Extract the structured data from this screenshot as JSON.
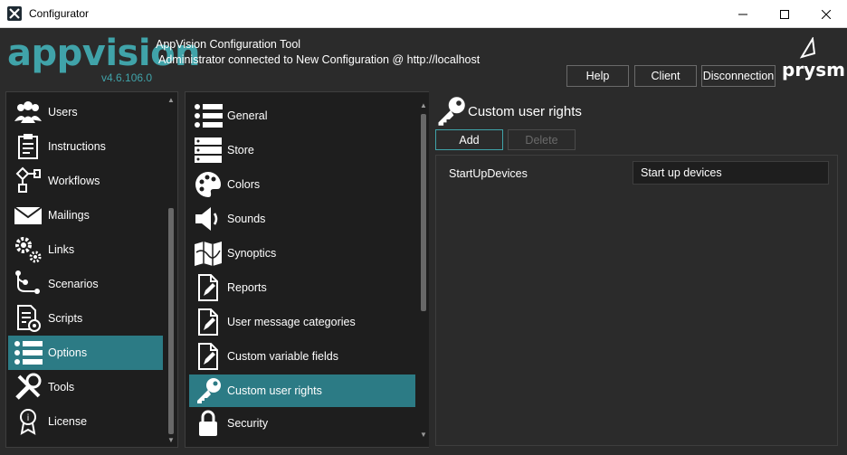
{
  "window": {
    "title": "Configurator",
    "minimize_glyph": "─",
    "maximize_glyph": "☐",
    "close_glyph": "✕"
  },
  "header": {
    "logo": "appvision",
    "version": "v4.6.106.0",
    "title": "AppVision Configuration Tool",
    "subtitle": "Administrator connected to New Configuration @ http://localhost",
    "buttons": {
      "help": "Help",
      "client": "Client",
      "disconnection": "Disconnection"
    },
    "brand": "prysm",
    "colors": {
      "accent": "#40a3a9",
      "selection": "#2c7b85"
    }
  },
  "nav": {
    "items": [
      {
        "label": "Users",
        "icon": "users-icon"
      },
      {
        "label": "Instructions",
        "icon": "clipboard-icon"
      },
      {
        "label": "Workflows",
        "icon": "workflow-icon"
      },
      {
        "label": "Mailings",
        "icon": "envelope-icon"
      },
      {
        "label": "Links",
        "icon": "gears-icon"
      },
      {
        "label": "Scenarios",
        "icon": "scenario-icon"
      },
      {
        "label": "Scripts",
        "icon": "script-icon"
      },
      {
        "label": "Options",
        "icon": "list-icon",
        "selected": true
      },
      {
        "label": "Tools",
        "icon": "tools-icon"
      },
      {
        "label": "License",
        "icon": "certificate-icon"
      }
    ]
  },
  "options": {
    "items": [
      {
        "label": "General",
        "icon": "list-icon"
      },
      {
        "label": "Store",
        "icon": "server-icon"
      },
      {
        "label": "Colors",
        "icon": "palette-icon"
      },
      {
        "label": "Sounds",
        "icon": "speaker-icon"
      },
      {
        "label": "Synoptics",
        "icon": "map-icon"
      },
      {
        "label": "Reports",
        "icon": "document-edit-icon"
      },
      {
        "label": "User message categories",
        "icon": "document-edit-icon"
      },
      {
        "label": "Custom variable fields",
        "icon": "document-edit-icon"
      },
      {
        "label": "Custom user rights",
        "icon": "key-icon",
        "selected": true
      },
      {
        "label": "Security",
        "icon": "lock-icon"
      }
    ]
  },
  "detail": {
    "title": "Custom user rights",
    "add_label": "Add",
    "delete_label": "Delete",
    "rights": [
      {
        "name": "StartUpDevices",
        "value": "Start up devices"
      }
    ]
  }
}
